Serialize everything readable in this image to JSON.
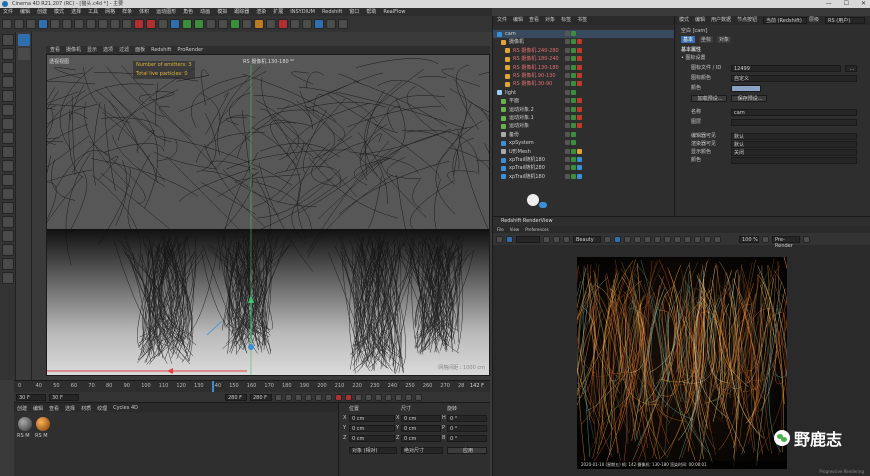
{
  "window": {
    "title": "Cinema 4D R21.207 (RC) - [猫头.c4d *] - 主要",
    "controls": [
      "—",
      "☐",
      "✕"
    ]
  },
  "menubar": [
    "文件",
    "编辑",
    "创建",
    "模式",
    "选择",
    "工具",
    "网格",
    "样条",
    "体积",
    "运动图形",
    "角色",
    "动画",
    "模拟",
    "跟踪器",
    "渲染",
    "扩展",
    "INSYDIUM",
    "Redshift",
    "窗口",
    "帮助",
    "RealFlow"
  ],
  "viewport": {
    "menu": [
      "查看",
      "摄像机",
      "显示",
      "选项",
      "过滤",
      "面板",
      "Redshift",
      "ProRender"
    ],
    "view_label": "透视视图",
    "camera_label": "RS 摄像机.130-180 ⁰⁰",
    "hud": {
      "emitters": "Number of emitters: 3",
      "particles": "Total live particles: 0"
    },
    "grid_label": "网格间距 : 1000 cm"
  },
  "timeline": {
    "ticks": [
      "0",
      "40",
      "50",
      "60",
      "70",
      "80",
      "90",
      "100",
      "110",
      "120",
      "130",
      "140",
      "150",
      "160",
      "170",
      "180",
      "190",
      "200",
      "210",
      "220",
      "230",
      "240",
      "250",
      "260",
      "270",
      "28"
    ],
    "current": "142 F",
    "start": "30 F",
    "start2": "30 F",
    "end": "280 F",
    "end2": "280 F"
  },
  "material_panel": {
    "tabs": [
      "创建",
      "编辑",
      "查看",
      "选择",
      "材质",
      "纹理",
      "Cycles 4D"
    ],
    "materials": [
      {
        "name": "RS M"
      },
      {
        "name": "RS M"
      }
    ]
  },
  "coord_panel": {
    "headers": [
      "位置",
      "尺寸",
      "旋转"
    ],
    "rows": [
      {
        "axis": "X",
        "pos": "0 cm",
        "size": "0 cm",
        "rot_axis": "H",
        "rot": "0 °"
      },
      {
        "axis": "Y",
        "pos": "0 cm",
        "size": "0 cm",
        "rot_axis": "P",
        "rot": "0 °"
      },
      {
        "axis": "Z",
        "pos": "0 cm",
        "size": "0 cm",
        "rot_axis": "B",
        "rot": "0 °"
      }
    ],
    "mode1": "对象 (相对)",
    "mode2": "绝对尺寸",
    "apply": "应用"
  },
  "object_manager": {
    "tabs": [
      "文件",
      "编辑",
      "查看",
      "对象",
      "标签",
      "书签"
    ],
    "rows": [
      {
        "name": "cam",
        "color": "#3a8fd6",
        "indent": 0
      },
      {
        "name": "摄像机",
        "color": "#e0a33a",
        "indent": 4
      },
      {
        "name": "RS 摄像机.240-280",
        "color": "#e0a33a",
        "indent": 8
      },
      {
        "name": "RS 摄像机.180-240",
        "color": "#e0a33a",
        "indent": 8
      },
      {
        "name": "RS 摄像机.130-180",
        "color": "#e0a33a",
        "indent": 8
      },
      {
        "name": "RS 摄像机.90-130",
        "color": "#e0a33a",
        "indent": 8
      },
      {
        "name": "RS 摄像机.30-90",
        "color": "#e0a33a",
        "indent": 8
      },
      {
        "name": "light",
        "color": "#9ad0ff",
        "indent": 0
      },
      {
        "name": "平面",
        "color": "#6ab04c",
        "indent": 4
      },
      {
        "name": "运动对象.2",
        "color": "#6ab04c",
        "indent": 4
      },
      {
        "name": "运动对象.1",
        "color": "#6ab04c",
        "indent": 4
      },
      {
        "name": "运动对象",
        "color": "#6ab04c",
        "indent": 4
      },
      {
        "name": "备份",
        "color": "#aaaaaa",
        "indent": 4
      },
      {
        "name": "xpSystem",
        "color": "#3a8fd6",
        "indent": 4
      },
      {
        "name": "U形Mesh",
        "color": "#aaaaaa",
        "indent": 4
      },
      {
        "name": "xpTrail随机180",
        "color": "#3a8fd6",
        "indent": 4
      },
      {
        "name": "xpTrail随机280",
        "color": "#3a8fd6",
        "indent": 4
      },
      {
        "name": "xpTrail随机180",
        "color": "#3a8fd6",
        "indent": 4
      }
    ]
  },
  "attributes": {
    "tabs": [
      "模式",
      "编辑",
      "用户数据"
    ],
    "node": "节点按钮",
    "node_value": "当前 (Redshift)",
    "layer": "层级",
    "layer_value": "RS (用户)",
    "object_title": "空白 [cam]",
    "subtabs": [
      "基本",
      "坐标",
      "对象"
    ],
    "section": "基本属性",
    "subsection": "• 图标设置",
    "fields": [
      {
        "label": "图标文件 / ID",
        "value": "12499"
      },
      {
        "label": "图标颜色",
        "value": "自定义"
      },
      {
        "label": "颜色",
        "value": ""
      }
    ],
    "buttons": [
      "加载预设...",
      "保存预设..."
    ],
    "name_label": "名称",
    "name_value": "cam",
    "layer_label": "图层",
    "options": [
      {
        "label": "编辑器可见",
        "value": "默认"
      },
      {
        "label": "渲染器可见",
        "value": "默认"
      },
      {
        "label": "显示颜色",
        "value": "关闭"
      },
      {
        "label": "颜色",
        "value": ""
      }
    ]
  },
  "redshift": {
    "title": "Redshift RenderView",
    "menu": [
      "File",
      "View",
      "Preferences"
    ],
    "beauty": "Beauty",
    "zoom": "100 %",
    "aov": "Pre-Render",
    "progress_label": "Progressive Rendering",
    "caption": "2020-01-10 (星期五)  帧: 142  摄像机: 130-180  渲染时间: 00:00:01"
  },
  "watermark": {
    "text": "野鹿志"
  }
}
